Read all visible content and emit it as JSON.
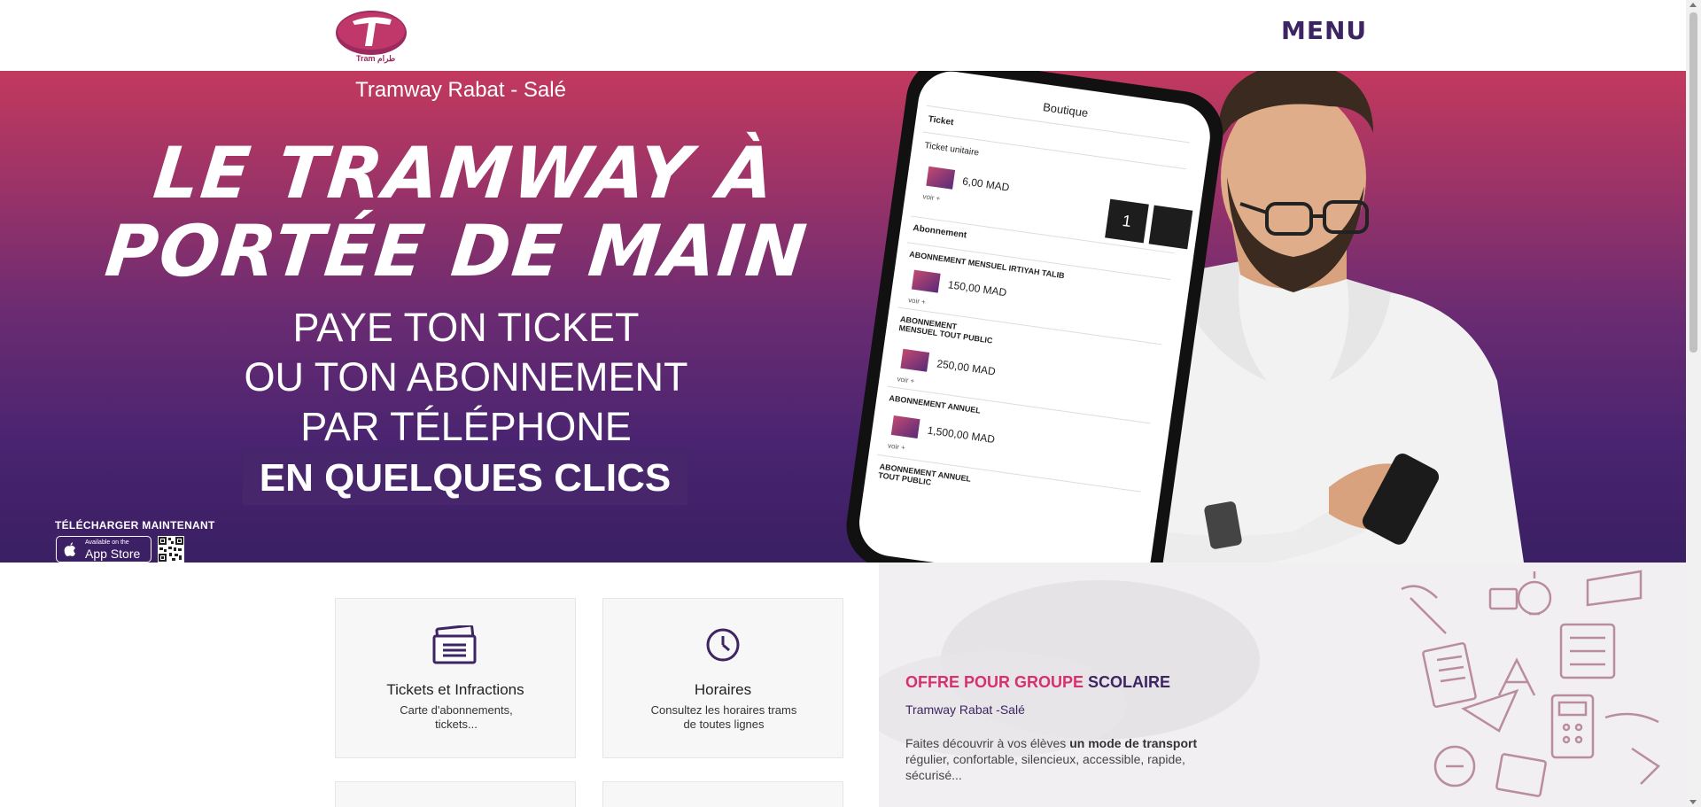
{
  "header": {
    "logo_text": "Tram طرام",
    "menu_label": "MENU"
  },
  "hero": {
    "subtitle": "Tramway Rabat - Salé",
    "title_line1": "LE TRAMWAY À",
    "title_line2": "PORTÉE DE MAIN",
    "line1": "PAYE TON TICKET",
    "line2": "OU TON ABONNEMENT",
    "line3": "PAR TÉLÉPHONE",
    "cta": "EN QUELQUES CLICS",
    "download_label": "TÉLÉCHARGER MAINTENANT",
    "appstore_small": "Available on the",
    "appstore_big": "App Store"
  },
  "phone": {
    "header": "Boutique",
    "section_ticket": "Ticket",
    "ticket_unitaire": "Ticket unitaire",
    "price1": "6,00 MAD",
    "qty": "1",
    "section_abonnement": "Abonnement",
    "abo1_title": "ABONNEMENT MENSUEL IRTIYAH TALIB",
    "price2": "150,00 MAD",
    "abo2_title": "ABONNEMENT MENSUEL TOUT PUBLIC",
    "price3": "250,00 MAD",
    "abo3_title": "ABONNEMENT ANNUEL",
    "price4": "1,500,00 MAD",
    "abo4_title": "ABONNEMENT ANNUEL TOUT PUBLIC",
    "voir": "voir +"
  },
  "cards": [
    {
      "title": "Tickets et Infractions",
      "desc": "Carte d'abonnements, tickets...",
      "icon": "tickets-icon"
    },
    {
      "title": "Horaires",
      "desc": "Consultez les horaires trams de toutes lignes",
      "icon": "clock-icon"
    }
  ],
  "offer": {
    "title_part1": "OFFRE POUR GROUPE",
    "title_part2": "SCOLAIRE",
    "subtitle": "Tramway Rabat -Salé",
    "text_before": "Faites découvrir à vos élèves",
    "text_bold": "un mode de transport",
    "text_after": "régulier, confortable, silencieux, accessible, rapide, sécurisé..."
  },
  "colors": {
    "brand_purple": "#3d2462",
    "brand_pink": "#d6316f"
  }
}
